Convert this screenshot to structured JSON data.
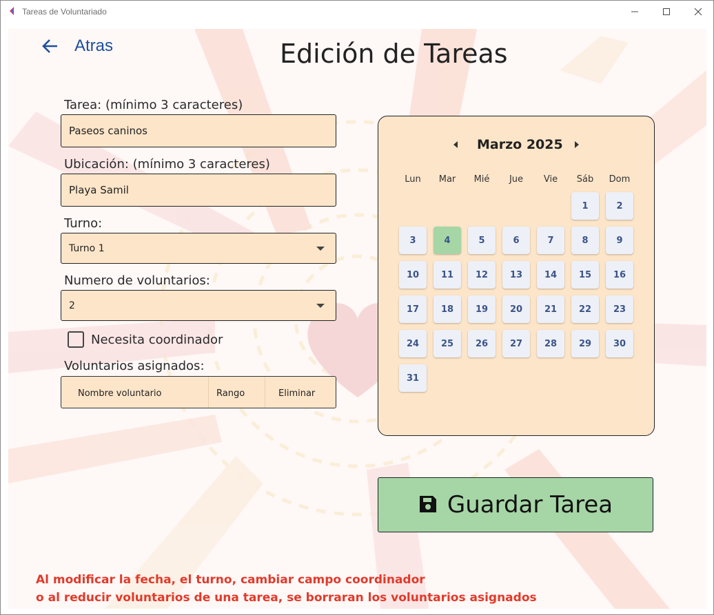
{
  "window": {
    "title": "Tareas de Voluntariado",
    "minimize": "—",
    "maximize": "☐",
    "close": "✕"
  },
  "header": {
    "back_label": "Atras",
    "page_title": "Edición de Tareas"
  },
  "form": {
    "tarea_label": "Tarea: (mínimo 3 caracteres)",
    "tarea_value": "Paseos caninos",
    "ubicacion_label": "Ubicación: (mínimo 3 caracteres)",
    "ubicacion_value": "Playa Samil",
    "turno_label": "Turno:",
    "turno_value": "Turno 1",
    "num_vol_label": "Numero de voluntarios:",
    "num_vol_value": "2",
    "coordinador_label": "Necesita coordinador",
    "coordinador_checked": false,
    "asignados_label": "Voluntarios asignados:",
    "table_columns": [
      "Nombre voluntario",
      "Rango",
      "Eliminar"
    ]
  },
  "calendar": {
    "month_label": "Marzo 2025",
    "weekdays": [
      "Lun",
      "Mar",
      "Mié",
      "Jue",
      "Vie",
      "Sáb",
      "Dom"
    ],
    "first_weekday_index": 5,
    "days_in_month": 31,
    "selected_day": 4
  },
  "save_button": {
    "label": "Guardar Tarea"
  },
  "warning": {
    "line1": "Al modificar la fecha, el turno, cambiar campo coordinador",
    "line2": "o al reducir voluntarios de una tarea, se borraran los voluntarios asignados"
  },
  "colors": {
    "field_bg": "#fde5c9",
    "save_bg": "#a6d6a6",
    "warning": "#e23a2a",
    "back_link": "#1f4e9c"
  }
}
